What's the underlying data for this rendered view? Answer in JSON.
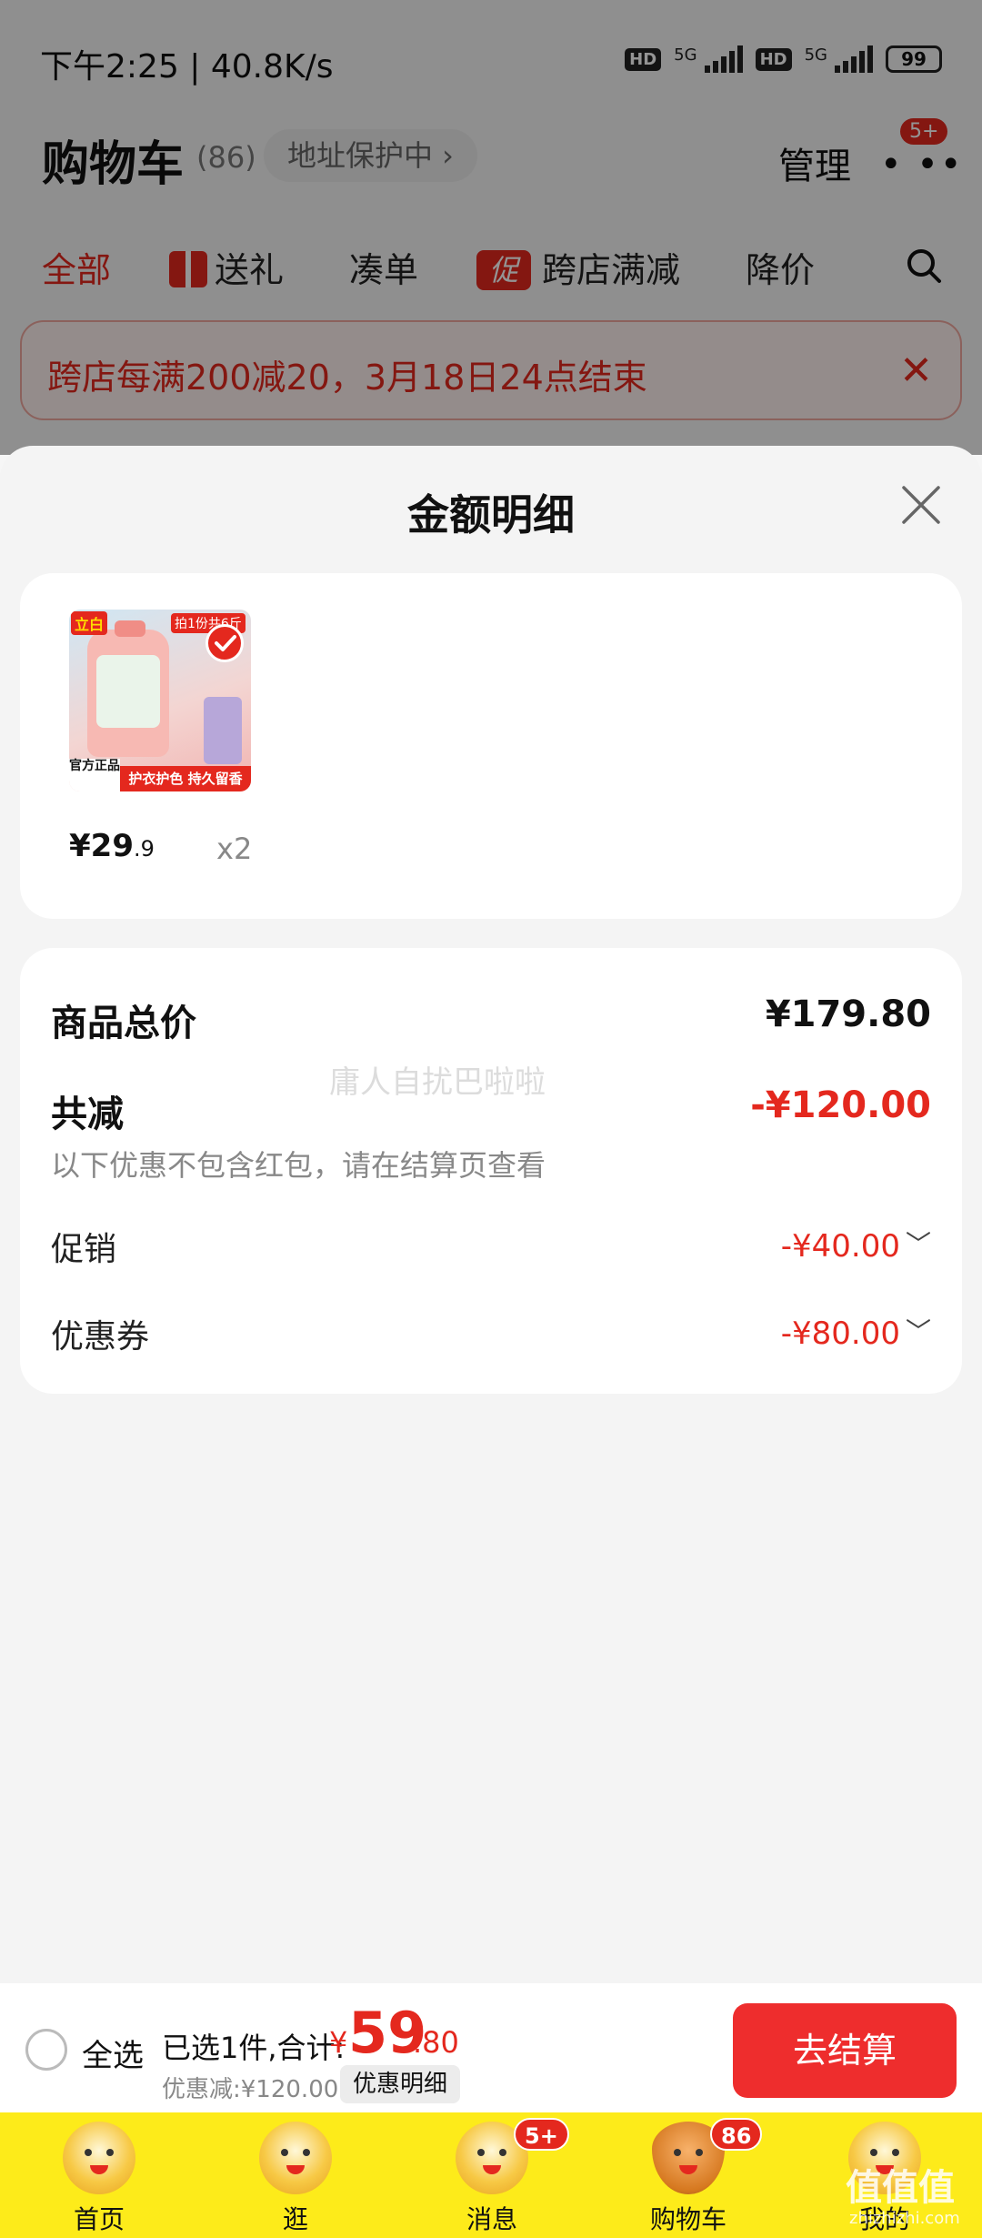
{
  "status_bar": {
    "time": "下午2:25 | 40.8K/s",
    "hd1": "HD",
    "net1": "5G",
    "hd2": "HD",
    "net2": "5G",
    "battery": "99"
  },
  "cart_header": {
    "title": "购物车",
    "count": "(86)",
    "address": "地址保护中 ›",
    "manage": "管理",
    "more_badge": "5+"
  },
  "filter_tabs": {
    "all": "全部",
    "gift": "送礼",
    "combine": "凑单",
    "promo_tag": "促",
    "cross_store": "跨店满减",
    "price_drop": "降价"
  },
  "notice": {
    "text": "跨店每满200减20，3月18日24点结束",
    "close": "✕"
  },
  "sheet": {
    "title": "金额明细",
    "product": {
      "brand": "立白",
      "official": "官方正品",
      "slogan": "护衣护色 持久留香",
      "top_badge": "拍1份共6斤",
      "price_main": "¥29",
      "price_dec": ".9",
      "qty": "x2"
    },
    "summary": {
      "total_label": "商品总价",
      "total_value": "¥179.80",
      "reduce_label": "共减",
      "reduce_value": "-¥120.00",
      "note": "以下优惠不包含红包，请在结算页查看",
      "promo_label": "促销",
      "promo_value": "-¥40.00",
      "coupon_label": "优惠券",
      "coupon_value": "-¥80.00",
      "watermark": "庸人自扰巴啦啦"
    }
  },
  "checkout": {
    "select_all": "全选",
    "selected_text": "已选1件,合计:",
    "yen": "¥",
    "total_int": "59",
    "total_dec": ".80",
    "discount_text": "优惠减:¥120.00",
    "detail_button": "优惠明细",
    "checkout_button": "去结算"
  },
  "tab_bar": {
    "tabs": [
      {
        "label": "首页",
        "badge": ""
      },
      {
        "label": "逛",
        "badge": ""
      },
      {
        "label": "消息",
        "badge": "5+"
      },
      {
        "label": "购物车",
        "badge": "86"
      },
      {
        "label": "我的",
        "badge": ""
      }
    ]
  },
  "watermark_corner": {
    "main": "值值值",
    "sub": "zhizhizhi.com"
  },
  "colors": {
    "accent_red": "#e4281e",
    "tab_bar_yellow": "#fdeb1a",
    "checkout_button": "#ee2d2d"
  }
}
